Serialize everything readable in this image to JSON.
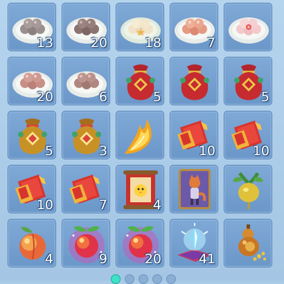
{
  "inventory": {
    "items": [
      {
        "icon": "dumpling-plate-grey-icon",
        "count": "13"
      },
      {
        "icon": "dumpling-plate-brown-icon",
        "count": "20"
      },
      {
        "icon": "dumpling-plate-cream-icon",
        "count": "18"
      },
      {
        "icon": "dumpling-plate-peach-icon",
        "count": "7"
      },
      {
        "icon": "dumpling-plate-pink-flower-icon",
        "count": ""
      },
      {
        "icon": "dumpling-plate-pink-icon",
        "count": "20"
      },
      {
        "icon": "dumpling-plate-taupe-icon",
        "count": "6"
      },
      {
        "icon": "red-lucky-bag-icon",
        "count": "5"
      },
      {
        "icon": "red-lucky-bag-icon",
        "count": ""
      },
      {
        "icon": "red-lucky-bag-icon",
        "count": "5"
      },
      {
        "icon": "gold-lucky-bag-icon",
        "count": "5"
      },
      {
        "icon": "gold-lucky-bag-icon",
        "count": "3"
      },
      {
        "icon": "golden-flame-feather-icon",
        "count": ""
      },
      {
        "icon": "red-envelope-scroll-icon",
        "count": "10"
      },
      {
        "icon": "red-envelope-scroll-icon",
        "count": "10"
      },
      {
        "icon": "red-envelope-scroll-icon",
        "count": "10"
      },
      {
        "icon": "red-envelope-scroll-icon",
        "count": "7"
      },
      {
        "icon": "chick-painting-scroll-icon",
        "count": "4"
      },
      {
        "icon": "fox-character-card-icon",
        "count": ""
      },
      {
        "icon": "golden-radish-icon",
        "count": ""
      },
      {
        "icon": "peach-fruit-icon",
        "count": "4"
      },
      {
        "icon": "glowing-peach-fruit-icon",
        "count": "9"
      },
      {
        "icon": "glowing-peach-fruit-icon",
        "count": "20"
      },
      {
        "icon": "crystal-on-carpet-icon",
        "count": "41"
      },
      {
        "icon": "gourd-with-coins-icon",
        "count": ""
      }
    ]
  },
  "pager": {
    "pages": 5,
    "active": 1
  }
}
